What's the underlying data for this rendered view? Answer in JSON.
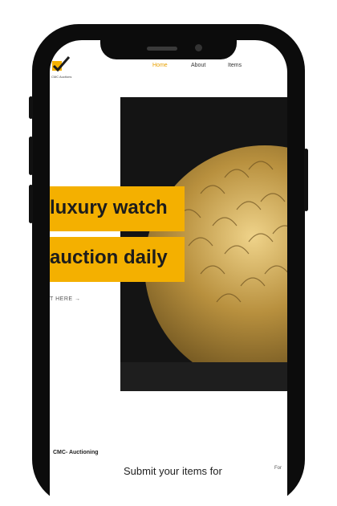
{
  "header": {
    "logo_text": "CMC Auctions",
    "nav": [
      "Home",
      "About",
      "Items"
    ]
  },
  "hero": {
    "line1": "luxury watch",
    "line2": "auction daily",
    "cta": "T HERE →"
  },
  "footer": {
    "brand": "CMC- Auctioning",
    "submit_text": "Submit your items for",
    "side_text": "For"
  },
  "colors": {
    "accent": "#f4b000",
    "nav_active": "#e8a000",
    "phone_frame": "#0c0c0c",
    "hero_bg": "#141414"
  }
}
